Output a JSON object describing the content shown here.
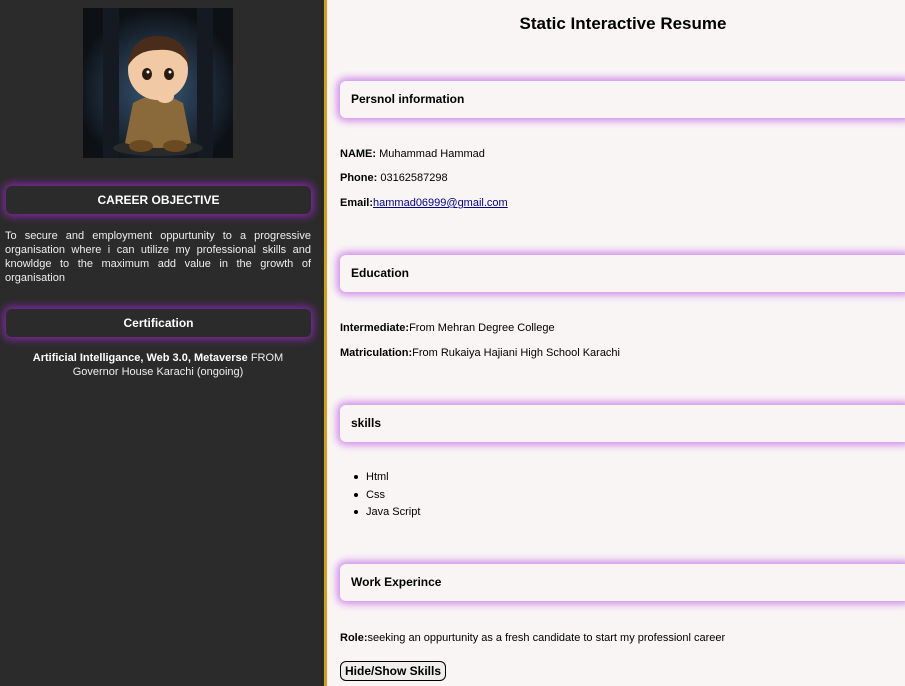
{
  "page": {
    "title": "Static Interactive Resume"
  },
  "sidebar": {
    "avatar_alt": "profile picture",
    "career_heading": "CAREER OBJECTIVE",
    "career_text": "To secure and employment oppurtunity to a progressive organisation where i can utilize my professional skills and knowldge to the maximum add value in the growth of organisation",
    "cert_heading": "Certification",
    "cert_bold": "Artificial Intelligance, Web 3.0, Metaverse",
    "cert_rest": " FROM Governor House Karachi (ongoing)"
  },
  "personal": {
    "heading": "Persnol information",
    "name_label": "NAME:",
    "name_value": " Muhammad Hammad",
    "phone_label": "Phone:",
    "phone_value": " 03162587298",
    "email_label": "Email:",
    "email_value": "hammad06999@gmail.com"
  },
  "education": {
    "heading": "Education",
    "inter_label": "Intermediate:",
    "inter_value": "From Mehran Degree College",
    "matric_label": "Matriculation:",
    "matric_value": "From Rukaiya Hajiani High School Karachi"
  },
  "skills": {
    "heading": "skills",
    "items": [
      "Html",
      "Css",
      "Java Script"
    ]
  },
  "work": {
    "heading": "Work Experince",
    "role_label": "Role:",
    "role_value": "seeking an oppurtunity as a fresh candidate to start my professionl career"
  },
  "toggle_button": "Hide/Show Skills",
  "colors": {
    "sidebar_bg": "#2b2b2b",
    "accent_border": "#d4a017",
    "sidebar_glow": "#7a2a9a",
    "section_glow": "#d08ae8"
  }
}
